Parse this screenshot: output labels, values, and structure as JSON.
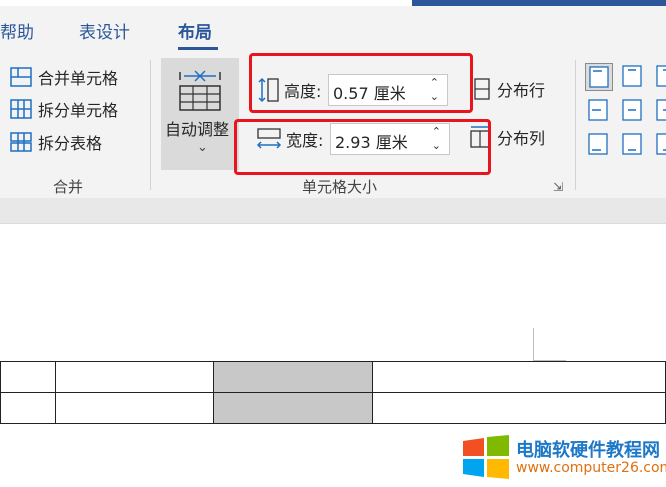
{
  "tabs": [
    {
      "label": "帮助"
    },
    {
      "label": "表设计"
    },
    {
      "label": "布局"
    }
  ],
  "merge_group": {
    "merge_cells": "合并单元格",
    "split_cells": "拆分单元格",
    "split_table": "拆分表格",
    "label": "合并"
  },
  "autofit": {
    "label": "自动调整"
  },
  "cell_size": {
    "height_label": "高度:",
    "height_value": "0.57 厘米",
    "width_label": "宽度:",
    "width_value": "2.93 厘米",
    "distribute_rows": "分布行",
    "distribute_cols": "分布列",
    "label": "单元格大小"
  },
  "watermark": {
    "title": "电脑软硬件教程网",
    "url": "www.computer26.com"
  },
  "colors": {
    "accent": "#2b579a",
    "highlight": "#e8141e",
    "icon": "#1f6fc2"
  }
}
